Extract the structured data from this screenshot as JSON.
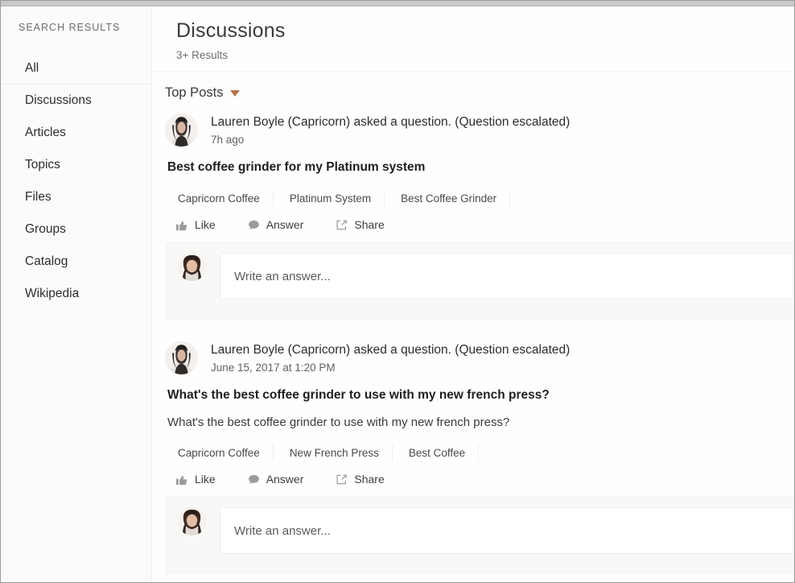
{
  "sidebar": {
    "title": "SEARCH RESULTS",
    "items": [
      {
        "label": "All"
      },
      {
        "label": "Discussions"
      },
      {
        "label": "Articles"
      },
      {
        "label": "Topics"
      },
      {
        "label": "Files"
      },
      {
        "label": "Groups"
      },
      {
        "label": "Catalog"
      },
      {
        "label": "Wikipedia"
      }
    ]
  },
  "header": {
    "title": "Discussions",
    "results": "3+ Results"
  },
  "sort": {
    "label": "Top Posts",
    "caret_icon": "chevron-down-icon",
    "caret_color": "#b5724a"
  },
  "actions": {
    "like": "Like",
    "answer": "Answer",
    "share": "Share",
    "like_icon": "thumbs-up-icon",
    "answer_icon": "speech-bubble-icon",
    "share_icon": "share-arrow-icon"
  },
  "composer": {
    "placeholder": "Write an answer...",
    "avatar_icon": "user-avatar"
  },
  "posts": [
    {
      "author": "Lauren Boyle (Capricorn) asked a question. (Question escalated)",
      "time": "7h ago",
      "title": "Best coffee grinder for my Platinum system",
      "body": "",
      "tags": [
        "Capricorn Coffee",
        "Platinum System",
        "Best Coffee Grinder"
      ]
    },
    {
      "author": "Lauren Boyle (Capricorn) asked a question. (Question escalated)",
      "time": "June 15, 2017 at 1:20 PM",
      "title": "What's the best coffee grinder to use with my new french press?",
      "body": "What's the best coffee grinder to use with my new french press?",
      "tags": [
        "Capricorn Coffee",
        "New French Press",
        "Best Coffee"
      ]
    }
  ]
}
